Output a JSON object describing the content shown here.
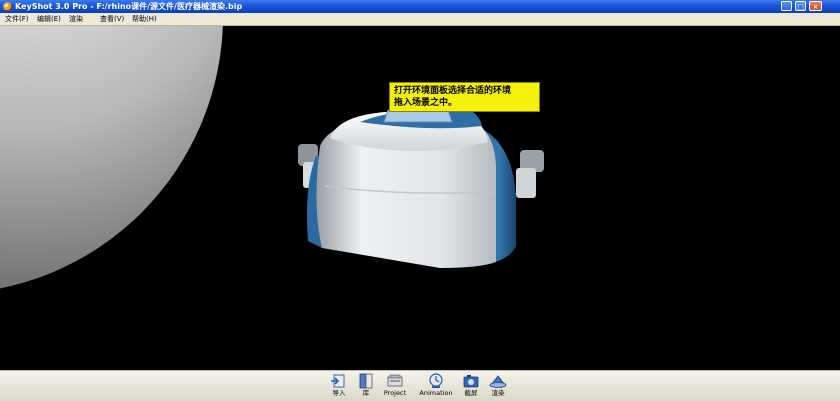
{
  "window": {
    "title": "KeyShot 3.0 Pro  - F:/rhino课件/源文件/医疗器械渲染.bip",
    "minimize_glyph": "_",
    "maximize_glyph": "□",
    "close_glyph": "×"
  },
  "menu": [
    "文件(F)",
    "编辑(E)",
    "渲染",
    "查看(V)",
    "帮助(H)"
  ],
  "tooltip": {
    "line1": "打开环境面板选择合适的环境",
    "line2": "拖入场景之中。"
  },
  "toolbar": [
    {
      "label": "导入",
      "icon": "import-icon"
    },
    {
      "label": "库",
      "icon": "library-icon"
    },
    {
      "label": "Project",
      "icon": "project-icon"
    },
    {
      "label": "Animation",
      "icon": "animation-icon"
    },
    {
      "label": "截屏",
      "icon": "screenshot-icon"
    },
    {
      "label": "渲染",
      "icon": "render-icon"
    }
  ],
  "colors": {
    "title_bar": "#1a55d6",
    "menu_bg": "#ece9d8",
    "viewport_bg": "#000000",
    "tooltip_bg": "#f5f00a",
    "device_body": "#e4e7ea",
    "device_accent": "#2a6aa0"
  }
}
